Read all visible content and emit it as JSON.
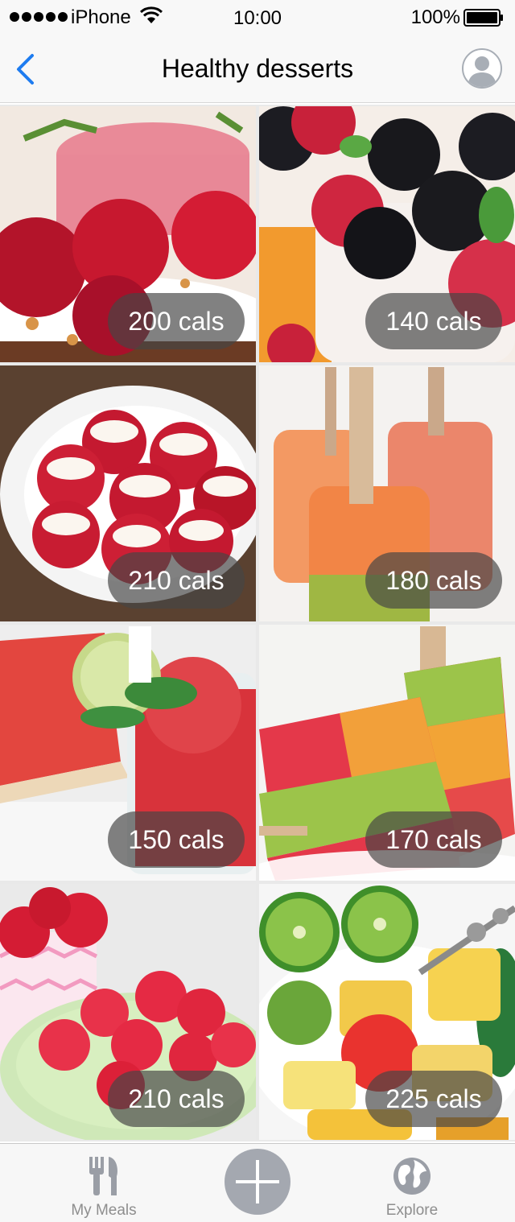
{
  "status_bar": {
    "carrier": "iPhone",
    "time": "10:00",
    "battery": "100%"
  },
  "nav": {
    "title": "Healthy desserts"
  },
  "desserts": [
    {
      "calories": "200 cals",
      "icon": "raspberry-panna-cotta"
    },
    {
      "calories": "140 cals",
      "icon": "berry-parfait"
    },
    {
      "calories": "210 cals",
      "icon": "stuffed-strawberries"
    },
    {
      "calories": "180 cals",
      "icon": "fruit-ice-pops"
    },
    {
      "calories": "150 cals",
      "icon": "watermelon-slush"
    },
    {
      "calories": "170 cals",
      "icon": "layered-ice-pops"
    },
    {
      "calories": "210 cals",
      "icon": "heart-gummies"
    },
    {
      "calories": "225 cals",
      "icon": "fruit-salad"
    }
  ],
  "tab_bar": {
    "my_meals_label": "My Meals",
    "explore_label": "Explore"
  },
  "colors": {
    "accent": "#1e7cf0",
    "badge": "#464646",
    "tab_icon": "#9a9ea6"
  }
}
